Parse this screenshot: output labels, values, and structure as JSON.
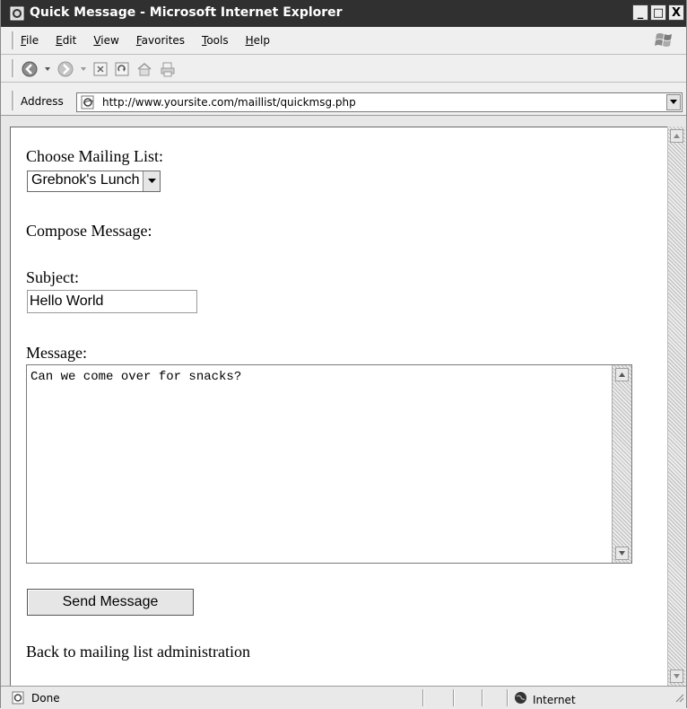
{
  "window": {
    "title": "Quick Message - Microsoft Internet Explorer",
    "controls": [
      "_",
      "□",
      "X"
    ]
  },
  "menu": {
    "items": [
      "File",
      "Edit",
      "View",
      "Favorites",
      "Tools",
      "Help"
    ]
  },
  "toolbar": {
    "icons": [
      "back-icon",
      "forward-icon",
      "stop-icon",
      "refresh-icon",
      "home-icon",
      "print-icon"
    ]
  },
  "address": {
    "label": "Address",
    "url": "http://www.yoursite.com/maillist/quickmsg.php"
  },
  "form": {
    "list_label": "Choose Mailing List:",
    "list_selected": "Grebnok's Lunch",
    "compose_label": "Compose Message:",
    "subject_label": "Subject:",
    "subject_value": "Hello World",
    "message_label": "Message:",
    "message_value": "Can we come over for snacks?",
    "send_label": "Send Message",
    "back_link": "Back to mailing list administration"
  },
  "status": {
    "text": "Done",
    "zone": "Internet"
  }
}
